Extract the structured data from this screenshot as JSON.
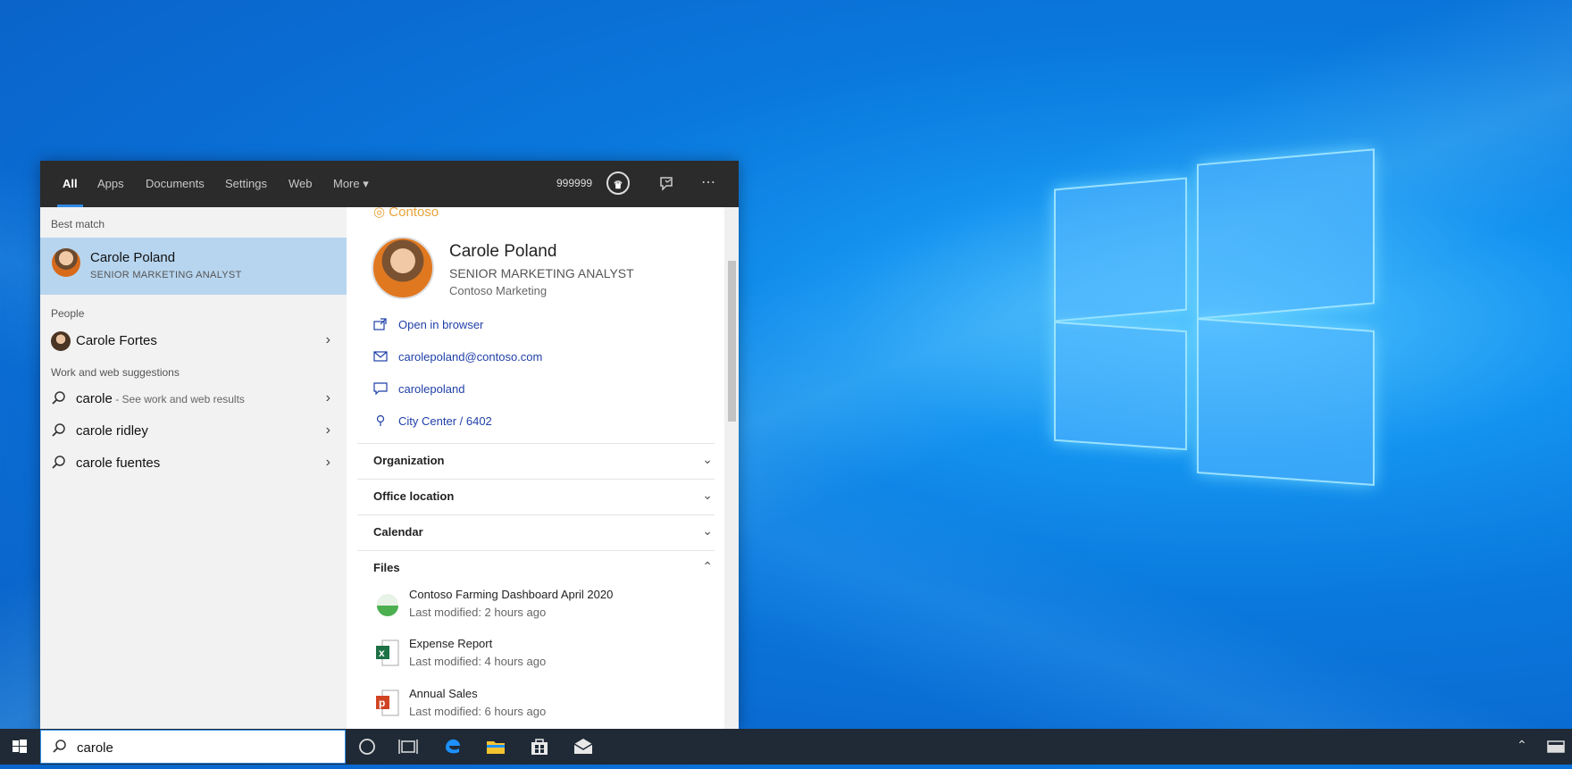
{
  "taskbar": {
    "search_value": "carole",
    "icons": [
      "windows-start-icon",
      "search-icon",
      "cortana-icon",
      "task-view-icon",
      "edge-icon",
      "file-explorer-icon",
      "store-icon",
      "mail-icon",
      "chevron-up-icon",
      "action-center-icon"
    ]
  },
  "search": {
    "tabs": [
      "All",
      "Apps",
      "Documents",
      "Settings",
      "Web",
      "More ▾"
    ],
    "active_tab": "All",
    "points": "999999"
  },
  "results": {
    "best_match_header": "Best match",
    "best_match": {
      "name": "Carole Poland",
      "title": "SENIOR MARKETING ANALYST"
    },
    "people_header": "People",
    "people": [
      {
        "name": "Carole Fortes"
      }
    ],
    "suggestions_header": "Work and web suggestions",
    "suggestions": [
      {
        "text": "carole",
        "hint": " - See work and web results"
      },
      {
        "text": "carole ridley",
        "hint": ""
      },
      {
        "text": "carole fuentes",
        "hint": ""
      }
    ]
  },
  "preview": {
    "brand": "Contoso",
    "name": "Carole Poland",
    "title": "SENIOR MARKETING ANALYST",
    "department": "Contoso Marketing",
    "links": [
      {
        "icon": "open-browser-icon",
        "label": "Open in browser"
      },
      {
        "icon": "mail-icon",
        "label": "carolepoland@contoso.com"
      },
      {
        "icon": "chat-icon",
        "label": "carolepoland"
      },
      {
        "icon": "location-icon",
        "label": "City Center / 6402"
      }
    ],
    "sections": [
      "Organization",
      "Office location",
      "Calendar",
      "Files"
    ],
    "files": [
      {
        "name": "Contoso Farming Dashboard April 2020",
        "modified": "Last modified: 2 hours ago"
      },
      {
        "name": "Expense Report",
        "modified": "Last modified: 4 hours ago"
      },
      {
        "name": "Annual Sales",
        "modified": "Last modified: 6 hours ago"
      }
    ]
  },
  "colors": {
    "accent": "#2f8ae6",
    "selected": "#b7d5ef",
    "link": "#1f3fa8",
    "brand": "#e8a23a"
  }
}
